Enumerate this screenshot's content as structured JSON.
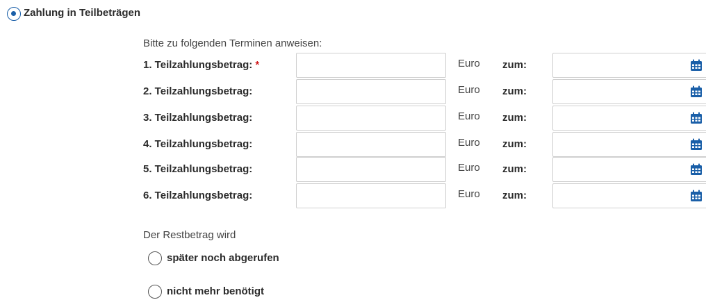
{
  "installment": {
    "option_label": "Zahlung in Teilbeträgen",
    "selected": true,
    "intro": "Bitte zu folgenden Terminen anweisen:",
    "required_marker": "*",
    "rows": [
      {
        "label": "1. Teilzahlungsbetrag:",
        "required": true,
        "amount": "",
        "unit": "Euro",
        "date_label": "zum:",
        "date": ""
      },
      {
        "label": "2. Teilzahlungsbetrag:",
        "required": false,
        "amount": "",
        "unit": "Euro",
        "date_label": "zum:",
        "date": ""
      },
      {
        "label": "3. Teilzahlungsbetrag:",
        "required": false,
        "amount": "",
        "unit": "Euro",
        "date_label": "zum:",
        "date": ""
      },
      {
        "label": "4. Teilzahlungsbetrag:",
        "required": false,
        "amount": "",
        "unit": "Euro",
        "date_label": "zum:",
        "date": ""
      },
      {
        "label": "5. Teilzahlungsbetrag:",
        "required": false,
        "amount": "",
        "unit": "Euro",
        "date_label": "zum:",
        "date": ""
      },
      {
        "label": "6. Teilzahlungsbetrag:",
        "required": false,
        "amount": "",
        "unit": "Euro",
        "date_label": "zum:",
        "date": ""
      }
    ],
    "date_icon": "calendar-icon"
  },
  "remainder": {
    "label": "Der Restbetrag wird",
    "options": [
      {
        "label": "später noch abgerufen",
        "selected": false
      },
      {
        "label": "nicht mehr benötigt",
        "selected": false
      }
    ]
  },
  "colors": {
    "accent": "#1a5fa8",
    "required": "#d0191c",
    "border": "#cfcfcf"
  }
}
